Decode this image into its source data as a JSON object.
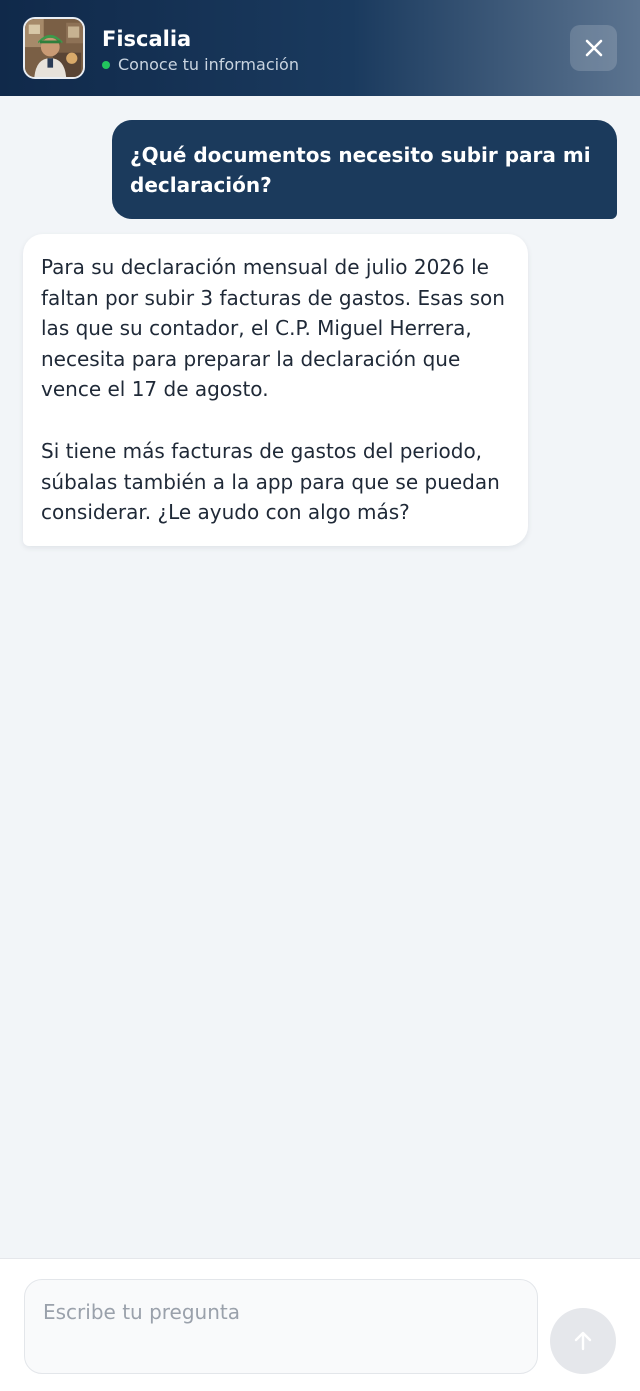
{
  "header": {
    "title": "Fiscalia",
    "status_text": "Conoce tu información",
    "status_color": "#22c55e",
    "close_icon": "close-icon"
  },
  "messages": [
    {
      "role": "user",
      "text": "¿Qué documentos necesito subir para mi declaración?"
    },
    {
      "role": "assistant",
      "paragraphs": [
        "Para su declaración mensual de julio 2026 le faltan por subir 3 facturas de gastos. Esas son las que su contador, el C.P. Miguel Herrera, necesita para preparar la declaración que vence el 17 de agosto.",
        "Si tiene más facturas de gastos del periodo, súbalas también a la app para que se puedan considerar. ¿Le ayudo con algo más?"
      ]
    }
  ],
  "composer": {
    "placeholder": "Escribe tu pregunta",
    "value": "",
    "send_icon": "arrow-up-icon"
  },
  "colors": {
    "header_dark": "#10294a",
    "user_bubble": "#1b3a5c",
    "background": "#f2f5f8"
  }
}
